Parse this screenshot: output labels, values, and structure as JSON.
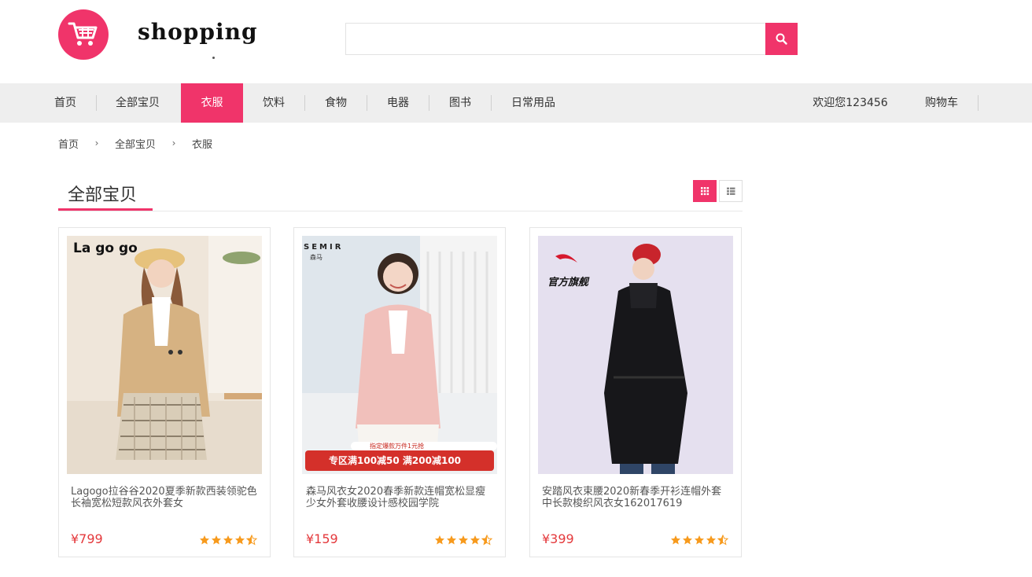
{
  "brand": {
    "logo_text": "shopping"
  },
  "search": {
    "placeholder": ""
  },
  "nav": {
    "items": [
      {
        "label": "首页"
      },
      {
        "label": "全部宝贝"
      },
      {
        "label": "衣服"
      },
      {
        "label": "饮料"
      },
      {
        "label": "食物"
      },
      {
        "label": "电器"
      },
      {
        "label": "图书"
      },
      {
        "label": "日常用品"
      }
    ],
    "active": "衣服",
    "welcome": "欢迎您123456",
    "cart": "购物车"
  },
  "breadcrumb": {
    "items": [
      "首页",
      "全部宝贝",
      "衣服"
    ],
    "separator": "›"
  },
  "section": {
    "title": "全部宝贝"
  },
  "products": [
    {
      "title": "Lagogo拉谷谷2020夏季新款西装领驼色长袖宽松短款风衣外套女",
      "price": "¥799",
      "rating": 4.5,
      "image_brand": "La go go"
    },
    {
      "title": "森马风衣女2020春季新款连帽宽松显瘦少女外套收腰设计感校园学院",
      "price": "¥159",
      "rating": 4.5,
      "image_brand": "SEMIR",
      "image_brand_sub": "森马",
      "promo_top": "指定爆款万件1元抢",
      "promo_main": "专区满100减50 满200减100"
    },
    {
      "title": "安踏风衣束腰2020新春季开衫连帽外套中长款梭织风衣女162017619",
      "price": "¥399",
      "rating": 4.5,
      "image_brand": "官方旗舰"
    }
  ],
  "colors": {
    "accent": "#f0346a",
    "price": "#e4393c",
    "star": "#f79a1d",
    "nav_bg": "#eeeeee"
  },
  "icons": {
    "logo": "shopping-cart-icon",
    "search": "search-icon",
    "view_grid": "grid-view-icon",
    "view_list": "list-view-icon",
    "rating": "star-icon"
  }
}
